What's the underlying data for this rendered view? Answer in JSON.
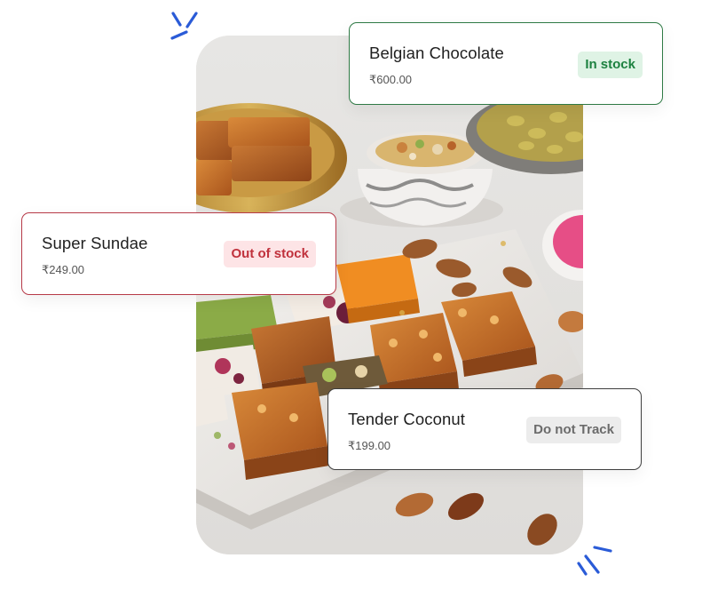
{
  "products": [
    {
      "name": "Belgian Chocolate",
      "price": "₹600.00",
      "status": "In stock"
    },
    {
      "name": "Super Sundae",
      "price": "₹249.00",
      "status": "Out of stock"
    },
    {
      "name": "Tender Coconut",
      "price": "₹199.00",
      "status": "Do not Track"
    }
  ],
  "status_colors": {
    "in_stock": {
      "border": "#2f7a45",
      "badge_bg": "#dff3e5",
      "badge_text": "#1d8140"
    },
    "out_of_stock": {
      "border": "#b73a48",
      "badge_bg": "#fde4e6",
      "badge_text": "#c0313c"
    },
    "do_not_track": {
      "border": "#3e3e3e",
      "badge_bg": "#ececec",
      "badge_text": "#6b6b6b"
    }
  },
  "accent_color": "#2a5bd7",
  "icons": {
    "sparkle": "sparkle-lines-icon"
  },
  "photo": {
    "subject": "assorted Indian sweets (barfi) with nuts on marble board"
  }
}
